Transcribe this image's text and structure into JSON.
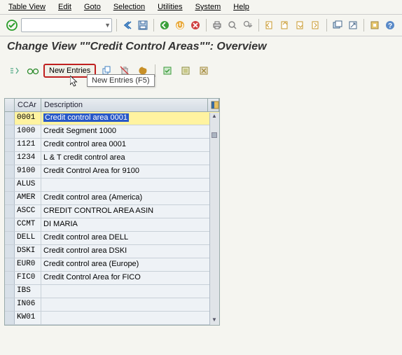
{
  "menubar": {
    "items": [
      "Table View",
      "Edit",
      "Goto",
      "Selection",
      "Utilities",
      "System",
      "Help"
    ]
  },
  "toolbar1": {
    "cmd_value": ""
  },
  "page": {
    "title": "Change View \"\"Credit Control Areas\"\": Overview"
  },
  "toolbar2": {
    "new_entries_label": "New Entries",
    "tooltip": "New Entries   (F5)"
  },
  "table": {
    "columns": {
      "code": "CCAr",
      "desc": "Description"
    },
    "rows": [
      {
        "code": "0001",
        "desc": "Credit control area 0001",
        "selected": true
      },
      {
        "code": "1000",
        "desc": "Credit Segment 1000"
      },
      {
        "code": "1121",
        "desc": "Credit control area 0001"
      },
      {
        "code": "1234",
        "desc": "L & T credit control area"
      },
      {
        "code": "9100",
        "desc": "Credit Control Area for 9100"
      },
      {
        "code": "ALUS",
        "desc": ""
      },
      {
        "code": "AMER",
        "desc": "Credit control area (America)"
      },
      {
        "code": "ASCC",
        "desc": "CREDIT CONTROL AREA ASIN"
      },
      {
        "code": "CCMT",
        "desc": "DI MARIA"
      },
      {
        "code": "DELL",
        "desc": "Credit control area DELL"
      },
      {
        "code": "DSKI",
        "desc": "Credit control area DSKI"
      },
      {
        "code": "EUR0",
        "desc": "Credit control area (Europe)"
      },
      {
        "code": "FIC0",
        "desc": "Credit Control Area for FICO"
      },
      {
        "code": "IBS",
        "desc": ""
      },
      {
        "code": "IN06",
        "desc": ""
      },
      {
        "code": "KW01",
        "desc": ""
      }
    ]
  },
  "colors": {
    "highlight_border": "#c02020",
    "selection_row": "#fff3a0",
    "selection_text_bg": "#2858c8"
  }
}
